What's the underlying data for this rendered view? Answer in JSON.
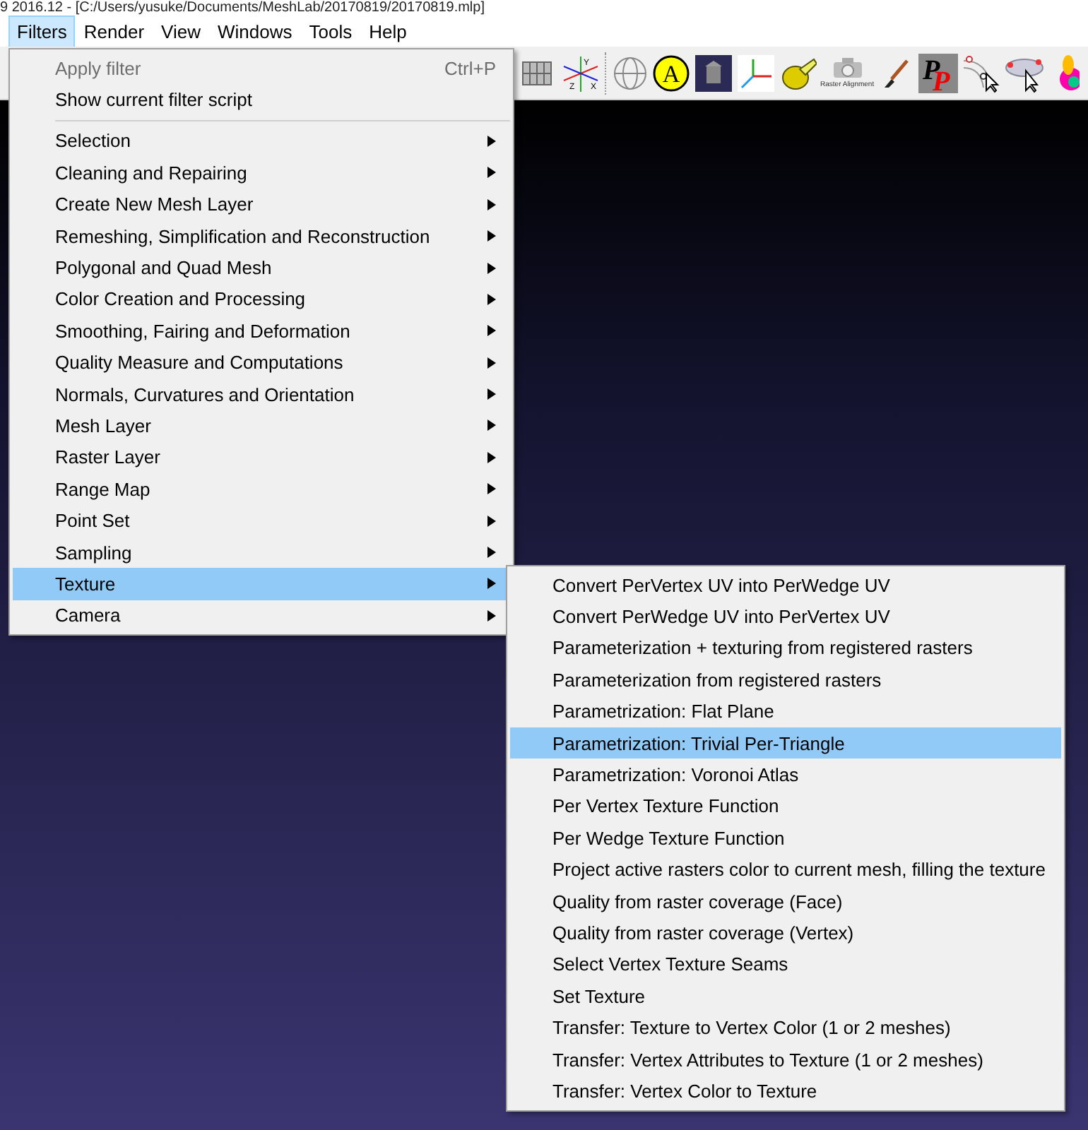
{
  "window": {
    "title": "9 2016.12 - [C:/Users/yusuke/Documents/MeshLab/20170819/20170819.mlp]"
  },
  "menubar": [
    {
      "label": "Filters",
      "selected": true
    },
    {
      "label": "Render",
      "selected": false
    },
    {
      "label": "View",
      "selected": false
    },
    {
      "label": "Windows",
      "selected": false
    },
    {
      "label": "Tools",
      "selected": false
    },
    {
      "label": "Help",
      "selected": false
    }
  ],
  "toolbar": [
    {
      "kind": "grid"
    },
    {
      "kind": "axes",
      "text": [
        "Y",
        "Z",
        "X"
      ]
    },
    {
      "kind": "sep"
    },
    {
      "kind": "globe"
    },
    {
      "kind": "circle",
      "text": [
        "A"
      ]
    },
    {
      "kind": "building"
    },
    {
      "kind": "frame"
    },
    {
      "kind": "tape"
    },
    {
      "kind": "camera",
      "text": [
        "Raster Alignment"
      ]
    },
    {
      "kind": "brush"
    },
    {
      "kind": "pp",
      "text": [
        "P",
        "P"
      ]
    },
    {
      "kind": "points"
    },
    {
      "kind": "ellipse"
    },
    {
      "kind": "bunny"
    }
  ],
  "filters_menu": {
    "items": [
      {
        "kind": "action",
        "label": "Apply filter",
        "shortcut": "Ctrl+P",
        "disabled": true,
        "selected": false
      },
      {
        "kind": "action",
        "label": "Show current filter script",
        "disabled": false,
        "selected": false
      },
      {
        "kind": "separator"
      },
      {
        "kind": "submenu",
        "label": "Selection",
        "selected": false
      },
      {
        "kind": "submenu",
        "label": "Cleaning and Repairing",
        "selected": false
      },
      {
        "kind": "submenu",
        "label": "Create New Mesh Layer",
        "selected": false
      },
      {
        "kind": "submenu",
        "label": "Remeshing, Simplification and Reconstruction",
        "selected": false
      },
      {
        "kind": "submenu",
        "label": "Polygonal and Quad Mesh",
        "selected": false
      },
      {
        "kind": "submenu",
        "label": "Color Creation and Processing",
        "selected": false
      },
      {
        "kind": "submenu",
        "label": "Smoothing, Fairing and Deformation",
        "selected": false
      },
      {
        "kind": "submenu",
        "label": "Quality Measure and Computations",
        "selected": false
      },
      {
        "kind": "submenu",
        "label": "Normals, Curvatures and Orientation",
        "selected": false
      },
      {
        "kind": "submenu",
        "label": "Mesh Layer",
        "selected": false
      },
      {
        "kind": "submenu",
        "label": "Raster Layer",
        "selected": false
      },
      {
        "kind": "submenu",
        "label": "Range Map",
        "selected": false
      },
      {
        "kind": "submenu",
        "label": "Point Set",
        "selected": false
      },
      {
        "kind": "submenu",
        "label": "Sampling",
        "selected": false
      },
      {
        "kind": "submenu",
        "label": "Texture",
        "selected": true
      },
      {
        "kind": "submenu",
        "label": "Camera",
        "selected": false
      }
    ]
  },
  "texture_submenu": {
    "items": [
      {
        "label": "Convert PerVertex UV into PerWedge UV",
        "selected": false
      },
      {
        "label": "Convert PerWedge UV into PerVertex UV",
        "selected": false
      },
      {
        "label": "Parameterization + texturing from registered rasters",
        "selected": false
      },
      {
        "label": "Parameterization from registered rasters",
        "selected": false
      },
      {
        "label": "Parametrization: Flat Plane",
        "selected": false
      },
      {
        "label": "Parametrization: Trivial Per-Triangle",
        "selected": true
      },
      {
        "label": "Parametrization: Voronoi Atlas",
        "selected": false
      },
      {
        "label": "Per Vertex Texture Function",
        "selected": false
      },
      {
        "label": "Per Wedge Texture Function",
        "selected": false
      },
      {
        "label": "Project active rasters color to current mesh, filling the texture",
        "selected": false
      },
      {
        "label": "Quality from raster coverage (Face)",
        "selected": false
      },
      {
        "label": "Quality from raster coverage (Vertex)",
        "selected": false
      },
      {
        "label": "Select Vertex Texture Seams",
        "selected": false
      },
      {
        "label": "Set Texture",
        "selected": false
      },
      {
        "label": "Transfer: Texture to Vertex Color (1 or 2 meshes)",
        "selected": false
      },
      {
        "label": "Transfer: Vertex Attributes to Texture (1 or 2 meshes)",
        "selected": false
      },
      {
        "label": "Transfer: Vertex Color to Texture",
        "selected": false
      }
    ]
  }
}
